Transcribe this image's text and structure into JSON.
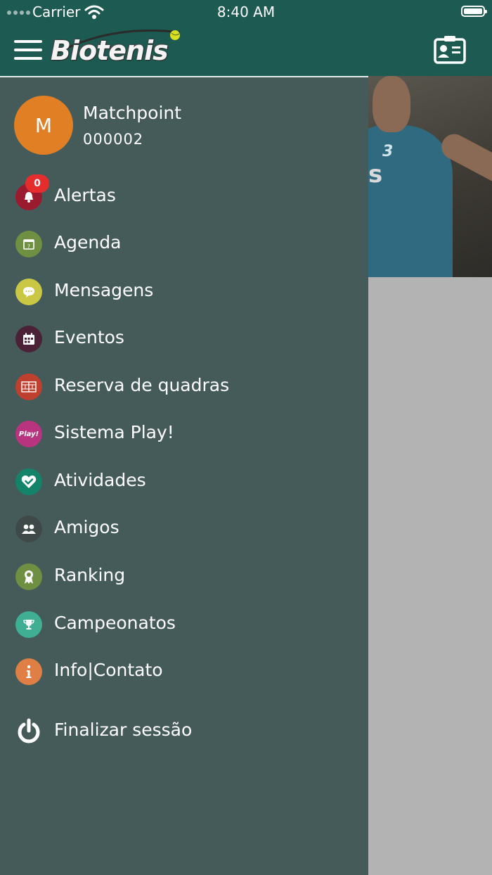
{
  "status": {
    "carrier": "Carrier",
    "time": "8:40 AM"
  },
  "header": {
    "brand": "Biotenis",
    "bg": "#1d5a52"
  },
  "profile": {
    "initial": "M",
    "name": "Matchpoint",
    "id": "000002"
  },
  "alerts_badge": "0",
  "menu": [
    {
      "label": "Alertas",
      "icon": "bell-icon",
      "color": "#9a1b2e"
    },
    {
      "label": "Agenda",
      "icon": "calendar-icon",
      "color": "#6f8f43"
    },
    {
      "label": "Mensagens",
      "icon": "chat-bubble-icon",
      "color": "#c9c744"
    },
    {
      "label": "Eventos",
      "icon": "event-calendar-icon",
      "color": "#4a2136"
    },
    {
      "label": "Reserva de quadras",
      "icon": "court-icon",
      "color": "#c0402f"
    },
    {
      "label": "Sistema Play!",
      "icon": "play-icon",
      "color": "#b8347f"
    },
    {
      "label": "Atividades",
      "icon": "heart-check-icon",
      "color": "#13836a"
    },
    {
      "label": "Amigos",
      "icon": "friends-icon",
      "color": "#3f4a48"
    },
    {
      "label": "Ranking",
      "icon": "ribbon-icon",
      "color": "#6f8f43"
    },
    {
      "label": "Campeonatos",
      "icon": "trophy-icon",
      "color": "#3fae93"
    },
    {
      "label": "Info|Contato",
      "icon": "info-icon",
      "color": "#e07f45"
    }
  ],
  "logout": {
    "label": "Finalizar sessão",
    "icon": "power-icon"
  },
  "play_icon_text": "Play!"
}
